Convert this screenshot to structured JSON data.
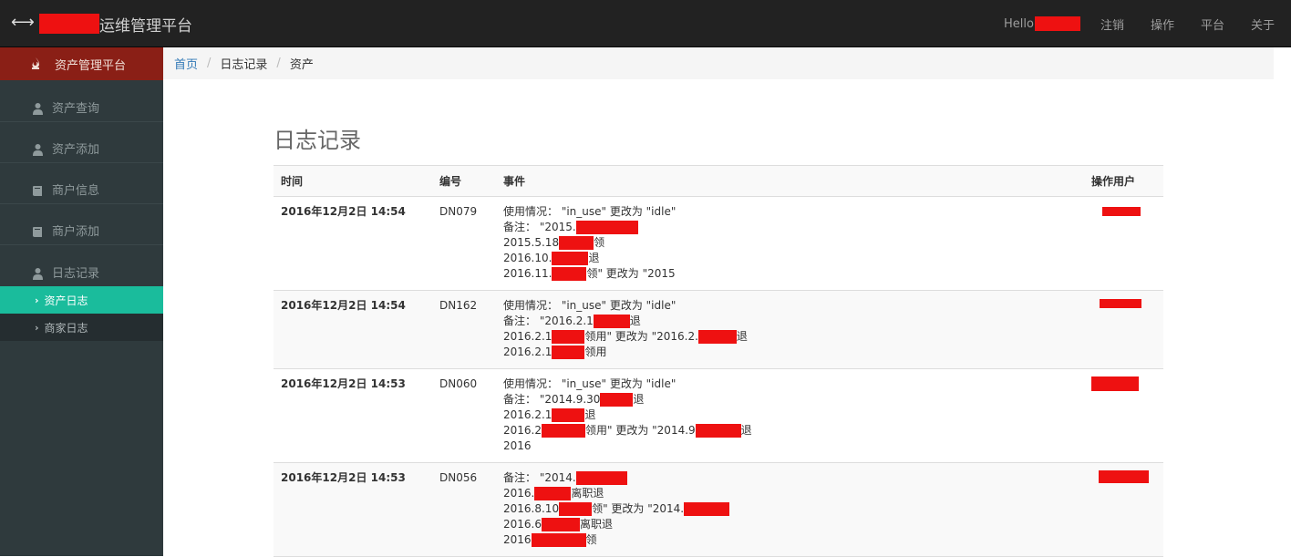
{
  "navbar": {
    "brand_suffix": "运维管理平台",
    "hello": "Hello",
    "links": [
      "注销",
      "操作",
      "平台",
      "关于"
    ]
  },
  "sidebar": {
    "header": "资产管理平台",
    "items": [
      {
        "label": "资产查询",
        "icon": "users-icon"
      },
      {
        "label": "资产添加",
        "icon": "users-icon"
      },
      {
        "label": "商户信息",
        "icon": "book-icon"
      },
      {
        "label": "商户添加",
        "icon": "book-icon"
      },
      {
        "label": "日志记录",
        "icon": "users-icon"
      }
    ],
    "subitems": [
      {
        "label": "资产日志",
        "active": true
      },
      {
        "label": "商家日志",
        "active": false
      }
    ]
  },
  "breadcrumb": {
    "home": "首页",
    "level1": "日志记录",
    "level2": "资产"
  },
  "main": {
    "title": "日志记录",
    "columns": {
      "time": "时间",
      "code": "编号",
      "event": "事件",
      "user": "操作用户"
    },
    "rows": [
      {
        "time": "2016年12月2日 14:54",
        "code": "DN079",
        "lines": [
          {
            "pre": "使用情况： \"in_use\" 更改为 \"idle\"",
            "post": ""
          },
          {
            "pre": "备注： \"2015.",
            "post": ""
          },
          {
            "pre": "2015.5.18",
            "post": "领"
          },
          {
            "pre": "2016.10.",
            "post": "退"
          },
          {
            "pre": "2016.11.",
            "post": "领\" 更改为 \"2015"
          }
        ]
      },
      {
        "time": "2016年12月2日 14:54",
        "code": "DN162",
        "lines": [
          {
            "pre": "使用情况： \"in_use\" 更改为 \"idle\"",
            "post": ""
          },
          {
            "pre": "备注： \"2016.2.1",
            "post": "退"
          },
          {
            "pre": "2016.2.1",
            "post": "领用\" 更改为 \"2016.2.",
            "post2": "退"
          },
          {
            "pre": "2016.2.1",
            "post": "领用"
          }
        ]
      },
      {
        "time": "2016年12月2日 14:53",
        "code": "DN060",
        "lines": [
          {
            "pre": "使用情况： \"in_use\" 更改为 \"idle\"",
            "post": ""
          },
          {
            "pre": "备注： \"2014.9.30",
            "post": "退"
          },
          {
            "pre": "2016.2.1",
            "post": "退"
          },
          {
            "pre": "2016.2",
            "post": "领用\" 更改为 \"2014.9",
            "post2": "退"
          },
          {
            "pre": "2016",
            "post": ""
          }
        ]
      },
      {
        "time": "2016年12月2日 14:53",
        "code": "DN056",
        "lines": [
          {
            "pre": "备注： \"2014.",
            "post": ""
          },
          {
            "pre": "2016.",
            "post": "离职退"
          },
          {
            "pre": "2016.8.10",
            "post": "领\" 更改为 \"2014.",
            "post2": ""
          },
          {
            "pre": "2016.6",
            "post": "离职退"
          },
          {
            "pre": "2016",
            "post": "领"
          }
        ]
      }
    ]
  },
  "colors": {
    "navbar": "#222222",
    "sidebar": "#2f3a3d",
    "sidebar_header": "#8a1f16",
    "active": "#1abc9c",
    "redaction": "#ee1111"
  }
}
